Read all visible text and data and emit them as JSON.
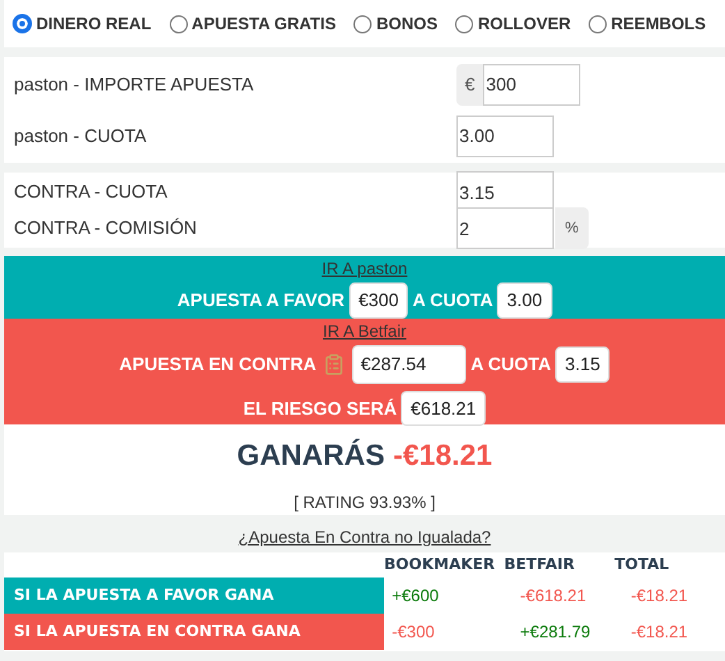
{
  "modes": [
    {
      "label": "DINERO REAL",
      "selected": true
    },
    {
      "label": "APUESTA GRATIS",
      "selected": false
    },
    {
      "label": "BONOS",
      "selected": false
    },
    {
      "label": "ROLLOVER",
      "selected": false
    },
    {
      "label": "REEMBOLS",
      "selected": false
    }
  ],
  "favor_fields": [
    {
      "label": "paston - IMPORTE APUESTA",
      "prefix": "€",
      "value": "300"
    },
    {
      "label": "paston - CUOTA",
      "value": "3.00"
    }
  ],
  "contra_fields": [
    {
      "label": "CONTRA - CUOTA",
      "value": "3.15"
    },
    {
      "label": "CONTRA - COMISIÓN",
      "value": "2",
      "suffix": "%"
    }
  ],
  "favor_panel": {
    "link": "IR A paston",
    "stake_label": "APUESTA A FAVOR",
    "stake": "€300",
    "odds_label": "A CUOTA",
    "odds": "3.00"
  },
  "contra_panel": {
    "link": "IR A Betfair",
    "stake_label": "APUESTA EN CONTRA",
    "stake": "€287.54",
    "odds_label": "A CUOTA",
    "odds": "3.15",
    "risk_label": "EL RIESGO SERÁ",
    "risk": "€618.21"
  },
  "result": {
    "label": "GANARÁS",
    "value": "-€18.21",
    "rating": "[ RATING 93.93% ]"
  },
  "unmatched_link": "¿Apuesta En Contra no Igualada?",
  "table": {
    "columns": [
      "BOOKMAKER",
      "BETFAIR",
      "TOTAL"
    ],
    "rows": [
      {
        "label": "SI LA APUESTA A FAVOR GANA",
        "color": "#00aeb0",
        "cells": [
          {
            "text": "+€600",
            "color": "#0a7a0a"
          },
          {
            "text": "-€618.21",
            "color": "#f2564e"
          },
          {
            "text": "-€18.21",
            "color": "#f2564e"
          }
        ]
      },
      {
        "label": "SI LA APUESTA EN CONTRA GANA",
        "color": "#f2564e",
        "cells": [
          {
            "text": "-€300",
            "color": "#f2564e"
          },
          {
            "text": "+€281.79",
            "color": "#0a7a0a"
          },
          {
            "text": "-€18.21",
            "color": "#f2564e"
          }
        ]
      }
    ]
  }
}
